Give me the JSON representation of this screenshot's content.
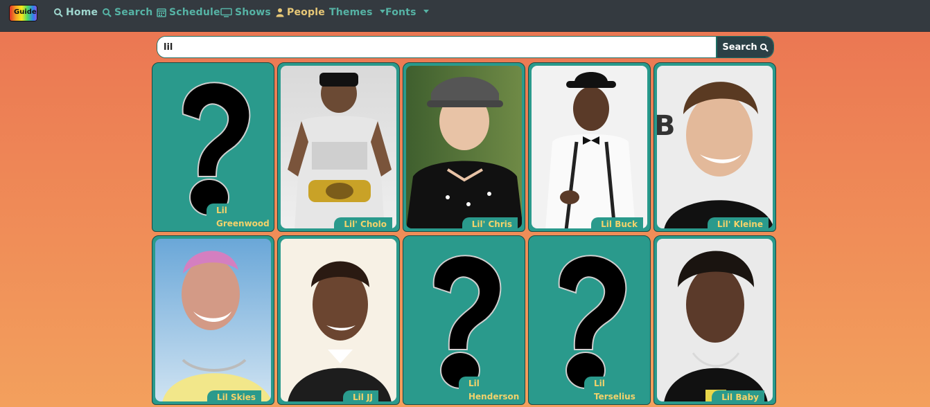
{
  "nav": {
    "brand_text": "Guide",
    "items": [
      {
        "label": "Home",
        "icon": "search-icon"
      },
      {
        "label": "Search",
        "icon": "search-icon"
      },
      {
        "label": "Schedule",
        "icon": "calendar-icon"
      },
      {
        "label": "Shows",
        "icon": "tv-icon"
      },
      {
        "label": "People",
        "icon": "user-icon"
      },
      {
        "label": "Themes",
        "icon": "caret-down-icon"
      },
      {
        "label": "Fonts",
        "icon": "caret-down-icon"
      }
    ]
  },
  "search": {
    "value": "lil",
    "button_label": "Search"
  },
  "people": [
    {
      "name": "Lil Greenwood",
      "has_photo": false,
      "photo_desc": "placeholder"
    },
    {
      "name": "Lil' Cholo",
      "has_photo": true,
      "photo_desc": "wrestler-with-belt"
    },
    {
      "name": "Lil' Chris",
      "has_photo": true,
      "photo_desc": "boy-in-cap"
    },
    {
      "name": "Lil Buck",
      "has_photo": true,
      "photo_desc": "man-in-hat"
    },
    {
      "name": "Lil' Kleine",
      "has_photo": true,
      "photo_desc": "smiling-man"
    },
    {
      "name": "Lil Skies",
      "has_photo": true,
      "photo_desc": "tattooed-rapper"
    },
    {
      "name": "Lil JJ",
      "has_photo": true,
      "photo_desc": "young-boy"
    },
    {
      "name": "Lil Henderson",
      "has_photo": false,
      "photo_desc": "placeholder"
    },
    {
      "name": "Lil Terselius",
      "has_photo": false,
      "photo_desc": "placeholder"
    },
    {
      "name": "Lil Baby",
      "has_photo": true,
      "photo_desc": "rapper"
    }
  ],
  "colors": {
    "accent": "#2a9a8c",
    "label_text": "#f3d26b",
    "nav_bg": "#343a40",
    "nav_text": "#56b3a5",
    "people_text": "#e7c877"
  }
}
